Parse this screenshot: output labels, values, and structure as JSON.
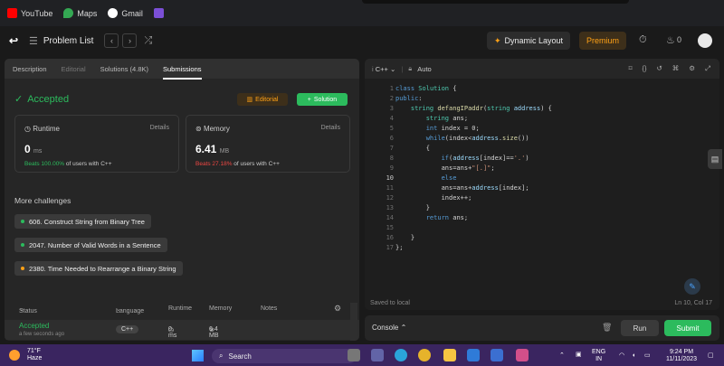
{
  "bookmarks": [
    {
      "label": "YouTube",
      "color": "#ff0000"
    },
    {
      "label": "Maps",
      "color": "#34a853"
    },
    {
      "label": "Gmail",
      "color": "#ea4335"
    }
  ],
  "header": {
    "problem_list": "Problem List",
    "dynamic_layout": "Dynamic Layout",
    "premium": "Premium",
    "fire_count": "0"
  },
  "left": {
    "tabs": [
      "Description",
      "Editorial",
      "Solutions (4.8K)",
      "Submissions"
    ],
    "status": "Accepted",
    "editorial_btn": "Editorial",
    "solution_btn": "Solution",
    "runtime": {
      "title": "Runtime",
      "details": "Details",
      "value": "0",
      "unit": "ms",
      "beats_pct": "Beats 100.00%",
      "beats_rest": "of users with C++"
    },
    "memory": {
      "title": "Memory",
      "details": "Details",
      "value": "6.41",
      "unit": "MB",
      "beats_pct": "Beats 27.18%",
      "beats_rest": "of users with C++"
    },
    "more_challenges": "More challenges",
    "challenges": [
      {
        "label": "606. Construct String from Binary Tree",
        "color": "#2cbb5d"
      },
      {
        "label": "2047. Number of Valid Words in a Sentence",
        "color": "#2cbb5d"
      },
      {
        "label": "2380. Time Needed to Rearrange a Binary String",
        "color": "#ffa116"
      }
    ],
    "table": {
      "headers": [
        "Status",
        "Language",
        "Runtime",
        "Memory",
        "Notes"
      ],
      "row": {
        "status": "Accepted",
        "time": "a few seconds ago",
        "language": "C++",
        "runtime": "0 ms",
        "memory": "6.4 MB"
      }
    }
  },
  "editor": {
    "language": "C++",
    "mode": "Auto",
    "lines": [
      "1",
      "2",
      "3",
      "4",
      "5",
      "6",
      "7",
      "8",
      "9",
      "10",
      "11",
      "12",
      "13",
      "14",
      "15",
      "16",
      "17"
    ],
    "saved": "Saved to local",
    "cursor": "Ln 10, Col 17"
  },
  "console": {
    "label": "Console",
    "run": "Run",
    "submit": "Submit"
  },
  "taskbar": {
    "temp": "71°F",
    "weather": "Haze",
    "search": "Search",
    "lang1": "ENG",
    "lang2": "IN",
    "time": "9:24 PM",
    "date": "11/11/2023"
  }
}
